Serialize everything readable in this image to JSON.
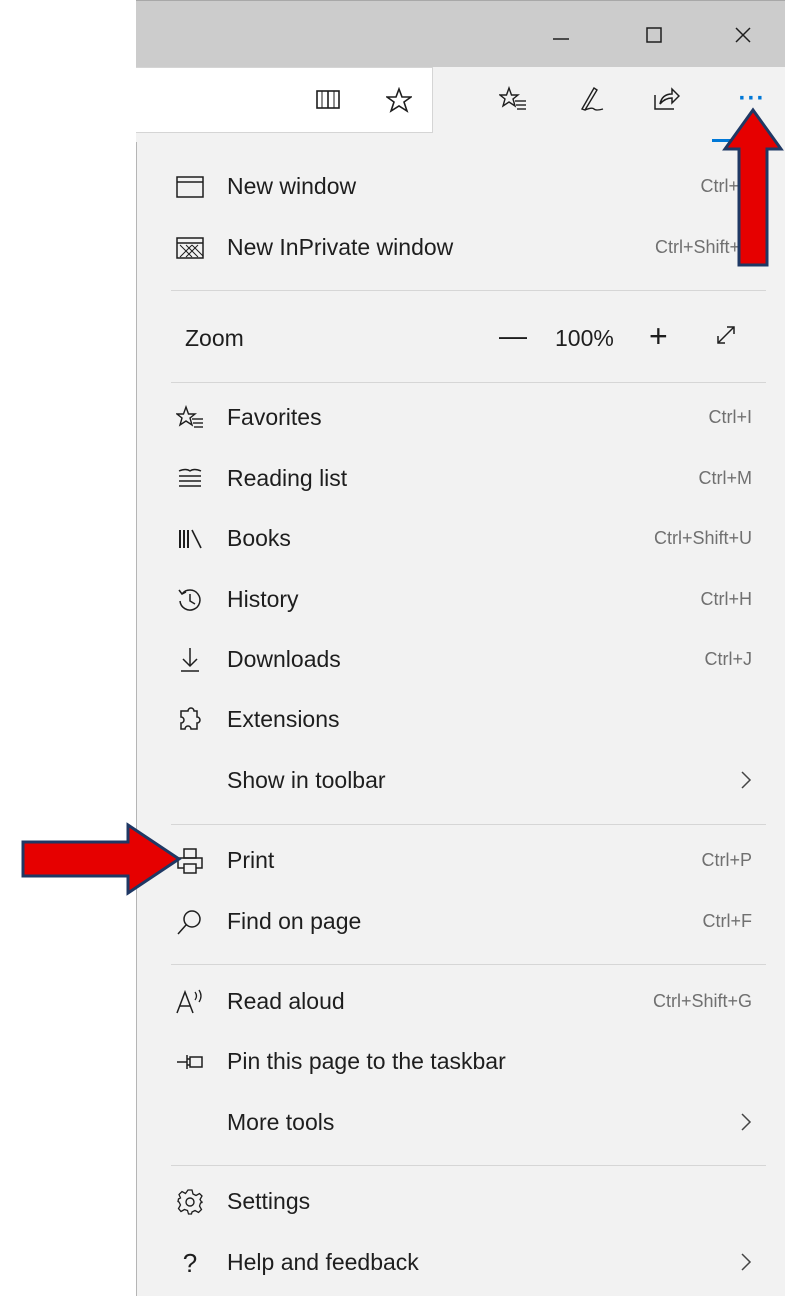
{
  "window_controls": {
    "minimize": "minimize-icon",
    "maximize": "maximize-icon",
    "close": "close-icon"
  },
  "toolbar": {
    "icons": [
      "reading-view-icon",
      "favorite-star-icon",
      "favorites-hub-icon",
      "pen-icon",
      "share-icon",
      "more-icon"
    ],
    "more_label": "···"
  },
  "menu": {
    "new_window": {
      "label": "New window",
      "shortcut": "Ctrl+N",
      "icon": "window-icon"
    },
    "new_inprivate": {
      "label": "New InPrivate window",
      "shortcut": "Ctrl+Shift+P",
      "icon": "inprivate-icon"
    },
    "zoom": {
      "label": "Zoom",
      "value": "100%",
      "minus": "—",
      "plus": "+",
      "fullscreen_icon": "fullscreen-icon"
    },
    "favorites": {
      "label": "Favorites",
      "shortcut": "Ctrl+I",
      "icon": "favorites-icon"
    },
    "reading_list": {
      "label": "Reading list",
      "shortcut": "Ctrl+M",
      "icon": "reading-list-icon"
    },
    "books": {
      "label": "Books",
      "shortcut": "Ctrl+Shift+U",
      "icon": "books-icon"
    },
    "history": {
      "label": "History",
      "shortcut": "Ctrl+H",
      "icon": "history-icon"
    },
    "downloads": {
      "label": "Downloads",
      "shortcut": "Ctrl+J",
      "icon": "download-icon"
    },
    "extensions": {
      "label": "Extensions",
      "icon": "extensions-icon"
    },
    "show_in_toolbar": {
      "label": "Show in toolbar"
    },
    "print": {
      "label": "Print",
      "shortcut": "Ctrl+P",
      "icon": "printer-icon"
    },
    "find_on_page": {
      "label": "Find on page",
      "shortcut": "Ctrl+F",
      "icon": "search-icon"
    },
    "read_aloud": {
      "label": "Read aloud",
      "shortcut": "Ctrl+Shift+G",
      "icon": "read-aloud-icon"
    },
    "pin_taskbar": {
      "label": "Pin this page to the taskbar",
      "icon": "pin-icon"
    },
    "more_tools": {
      "label": "More tools"
    },
    "settings": {
      "label": "Settings",
      "icon": "gear-icon"
    },
    "help": {
      "label": "Help and feedback",
      "icon": "help-icon"
    }
  },
  "annotations": {
    "arrow_color": "#e60000",
    "arrow_outline": "#1f3864"
  },
  "colors": {
    "titlebar": "#cccccc",
    "menu_bg": "#f2f2f2",
    "accent": "#0078d7"
  }
}
